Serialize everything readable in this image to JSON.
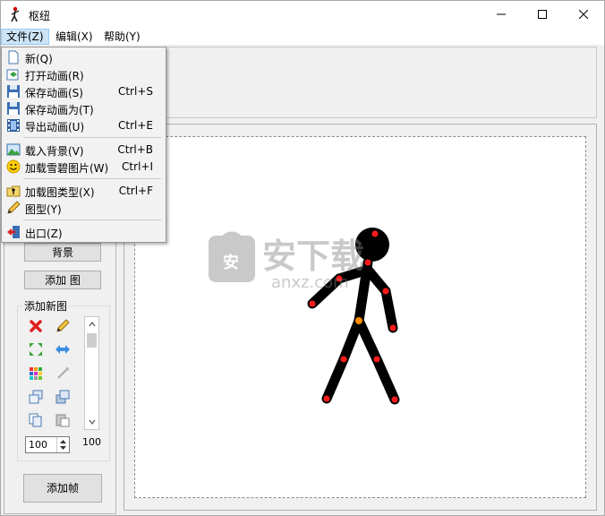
{
  "window": {
    "title": "枢纽"
  },
  "menubar": {
    "file": "文件(Z)",
    "edit": "编辑(X)",
    "help": "帮助(Y)"
  },
  "file_menu": {
    "items": [
      {
        "label": "新(Q)",
        "shortcut": "",
        "icon": "new-file-icon"
      },
      {
        "label": "打开动画(R)",
        "shortcut": "",
        "icon": "open-icon"
      },
      {
        "label": "保存动画(S)",
        "shortcut": "Ctrl+S",
        "icon": "save-icon"
      },
      {
        "label": "保存动画为(T)",
        "shortcut": "",
        "icon": "save-as-icon"
      },
      {
        "label": "导出动画(U)",
        "shortcut": "Ctrl+E",
        "icon": "film-icon"
      },
      {
        "label": "载入背景(V)",
        "shortcut": "Ctrl+B",
        "icon": "background-icon"
      },
      {
        "label": "加载雪碧图片(W)",
        "shortcut": "Ctrl+I",
        "icon": "smiley-icon"
      },
      {
        "label": "加载图类型(X)",
        "shortcut": "Ctrl+F",
        "icon": "figure-type-icon"
      },
      {
        "label": "图型(Y)",
        "shortcut": "",
        "icon": "pencil-icon"
      },
      {
        "label": "出口(Z)",
        "shortcut": "",
        "icon": "exit-icon"
      }
    ]
  },
  "left_panel": {
    "background_button": "背景",
    "add_figure_button": "添加 图",
    "new_figure_group": "添加新图",
    "spin_value": "100",
    "scale_value": "100",
    "add_frame_button": "添加帧"
  },
  "watermark": {
    "text": "安下载",
    "sub": "anxz.com"
  },
  "colors": {
    "joint_red": "#ff0000",
    "joint_orange": "#ff8c00",
    "figure": "#000000",
    "menu_highlight": "#cce4f7"
  }
}
